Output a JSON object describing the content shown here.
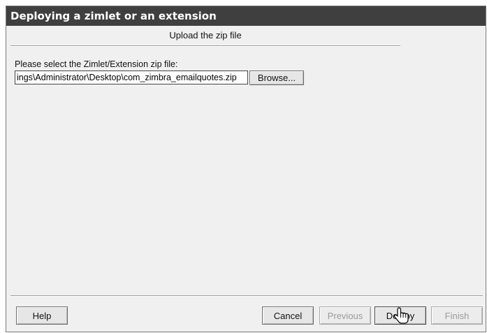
{
  "window": {
    "title": "Deploying a zimlet or an extension"
  },
  "step": {
    "title": "Upload the zip file"
  },
  "upload": {
    "label": "Please select the Zimlet/Extension zip file:",
    "file_value": "ings\\Administrator\\Desktop\\com_zimbra_emailquotes.zip",
    "browse_label": "Browse..."
  },
  "footer": {
    "help_label": "Help",
    "cancel_label": "Cancel",
    "previous_label": "Previous",
    "deploy_label": "Deploy",
    "finish_label": "Finish"
  },
  "icons": {
    "cursor": "hand-pointer-icon"
  }
}
